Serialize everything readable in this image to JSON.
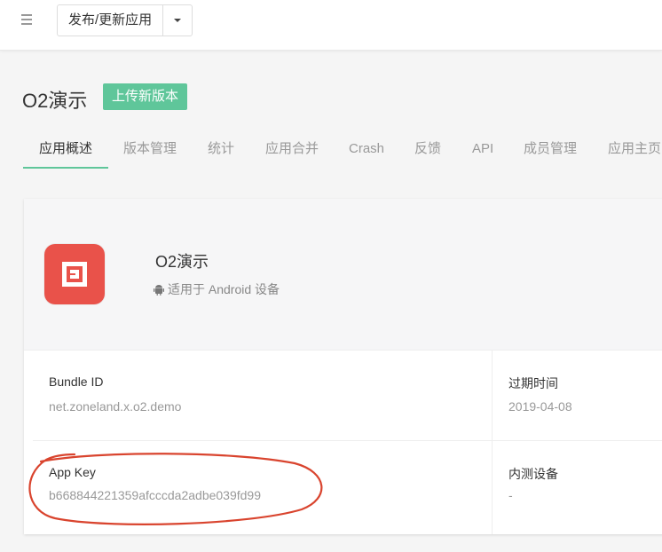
{
  "topbar": {
    "menu_icon": "hamburger-icon",
    "publish_label": "发布/更新应用",
    "caret_icon": "caret-down-icon"
  },
  "header": {
    "app_name": "O2演示",
    "upload_label": "上传新版本",
    "accent_color": "#5fc69a"
  },
  "tabs": [
    {
      "label": "应用概述",
      "active": true
    },
    {
      "label": "版本管理"
    },
    {
      "label": "统计"
    },
    {
      "label": "应用合并"
    },
    {
      "label": "Crash"
    },
    {
      "label": "反馈"
    },
    {
      "label": "API"
    },
    {
      "label": "成员管理"
    },
    {
      "label": "应用主页"
    }
  ],
  "card": {
    "app_name": "O2演示",
    "platform_icon": "android-icon",
    "platform_text": "适用于 Android 设备",
    "icon_color": "#e9524a",
    "fields": {
      "bundle_id_label": "Bundle ID",
      "bundle_id_value": "net.zoneland.x.o2.demo",
      "expire_label": "过期时间",
      "expire_value": "2019-04-08",
      "app_key_label": "App Key",
      "app_key_value": "b668844221359afcccda2adbe039fd99",
      "test_devices_label": "内测设备",
      "test_devices_value": "-"
    }
  },
  "annotation_color": "#d9442e"
}
